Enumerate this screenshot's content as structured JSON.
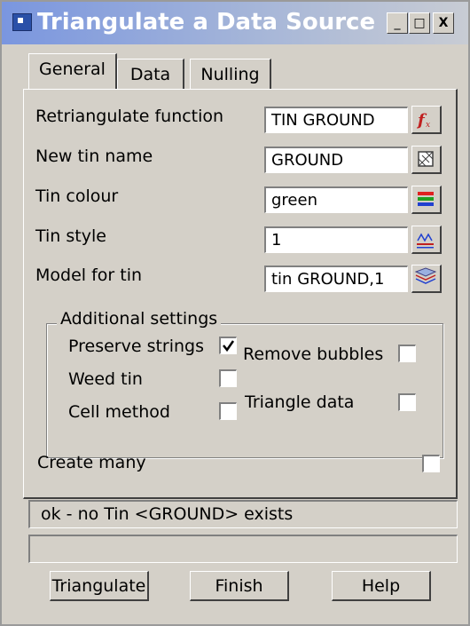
{
  "window": {
    "title": "Triangulate a Data Source",
    "minimize_label": "_",
    "maximize_label": "□",
    "close_label": "X"
  },
  "tabs": [
    {
      "label": "General",
      "active": true
    },
    {
      "label": "Data",
      "active": false
    },
    {
      "label": "Nulling",
      "active": false
    }
  ],
  "fields": {
    "retriangulate": {
      "label": "Retriangulate function",
      "value": "TIN GROUND",
      "icon": "function-icon"
    },
    "tin_name": {
      "label": "New tin name",
      "value": "GROUND",
      "icon": "tin-select-icon"
    },
    "tin_colour": {
      "label": "Tin colour",
      "value": "green",
      "icon": "colour-list-icon"
    },
    "tin_style": {
      "label": "Tin style",
      "value": "1",
      "icon": "linestyle-icon"
    },
    "model": {
      "label": "Model for tin",
      "value": "tin GROUND,1",
      "icon": "layers-icon"
    }
  },
  "additional_settings": {
    "title": "Additional settings",
    "preserve_strings": {
      "label": "Preserve strings",
      "checked": true
    },
    "remove_bubbles": {
      "label": "Remove bubbles",
      "checked": false
    },
    "weed_tin": {
      "label": "Weed tin",
      "checked": false
    },
    "triangle_data": {
      "label": "Triangle data",
      "checked": false
    },
    "cell_method": {
      "label": "Cell method",
      "checked": false
    }
  },
  "create_many": {
    "label": "Create many",
    "checked": false
  },
  "status": {
    "message": "ok - no Tin <GROUND> exists",
    "secondary": ""
  },
  "buttons": {
    "triangulate": "Triangulate",
    "finish": "Finish",
    "help": "Help"
  },
  "colors": {
    "face": "#d4d0c8",
    "title_gradient_start": "#7a96df",
    "function_red": "#c02020",
    "colour_icon_red": "#e02020",
    "colour_icon_green": "#20a020",
    "colour_icon_blue": "#2040d0"
  }
}
